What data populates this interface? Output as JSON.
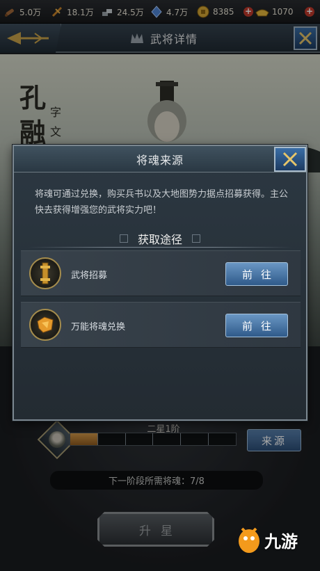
{
  "resources": [
    {
      "icon": "wood-icon",
      "value": "5.0万"
    },
    {
      "icon": "grain-icon",
      "value": "18.1万"
    },
    {
      "icon": "iron-icon",
      "value": "24.5万"
    },
    {
      "icon": "crystal-icon",
      "value": "4.7万"
    },
    {
      "icon": "coin-icon",
      "value": "8385"
    },
    {
      "icon": "gold-ingot-icon",
      "value": "1070"
    }
  ],
  "header": {
    "title": "武将详情"
  },
  "hero": {
    "name_chars": [
      "孔",
      "融"
    ],
    "courtesy_chars": [
      "字",
      "文"
    ]
  },
  "modal": {
    "title": "将魂来源",
    "description": "将魂可通过兑换，购买兵书以及大地图势力据点招募获得。主公快去获得增强您的武将实力吧！",
    "section_title": "获取途径",
    "routes": [
      {
        "label": "武将招募",
        "button": "前往",
        "icon": "recruit-scroll-icon"
      },
      {
        "label": "万能将魂兑换",
        "button": "前往",
        "icon": "universal-soul-icon"
      }
    ]
  },
  "star": {
    "caption": "二星1阶",
    "progress_segments": 6,
    "progress_fraction": 0.1667,
    "source_button": "来源",
    "need_text": "下一阶段所需将魂：7/8",
    "upgrade_button": "升星"
  },
  "watermark": {
    "text": "九游"
  },
  "colors": {
    "accent_blue": "#3a6ea6",
    "progress_fill": "#d49a4a",
    "gold_border": "#a48c4d"
  }
}
